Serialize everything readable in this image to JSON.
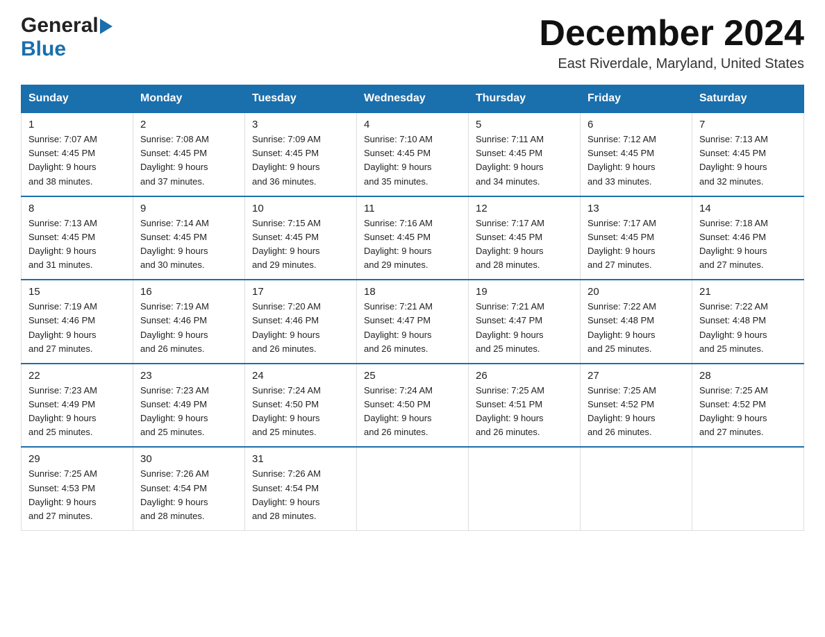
{
  "logo": {
    "general": "General",
    "blue": "Blue",
    "triangle_color": "#1a6fad"
  },
  "title": {
    "month_year": "December 2024",
    "location": "East Riverdale, Maryland, United States"
  },
  "weekdays": [
    "Sunday",
    "Monday",
    "Tuesday",
    "Wednesday",
    "Thursday",
    "Friday",
    "Saturday"
  ],
  "weeks": [
    [
      {
        "day": "1",
        "sunrise": "7:07 AM",
        "sunset": "4:45 PM",
        "daylight": "9 hours and 38 minutes."
      },
      {
        "day": "2",
        "sunrise": "7:08 AM",
        "sunset": "4:45 PM",
        "daylight": "9 hours and 37 minutes."
      },
      {
        "day": "3",
        "sunrise": "7:09 AM",
        "sunset": "4:45 PM",
        "daylight": "9 hours and 36 minutes."
      },
      {
        "day": "4",
        "sunrise": "7:10 AM",
        "sunset": "4:45 PM",
        "daylight": "9 hours and 35 minutes."
      },
      {
        "day": "5",
        "sunrise": "7:11 AM",
        "sunset": "4:45 PM",
        "daylight": "9 hours and 34 minutes."
      },
      {
        "day": "6",
        "sunrise": "7:12 AM",
        "sunset": "4:45 PM",
        "daylight": "9 hours and 33 minutes."
      },
      {
        "day": "7",
        "sunrise": "7:13 AM",
        "sunset": "4:45 PM",
        "daylight": "9 hours and 32 minutes."
      }
    ],
    [
      {
        "day": "8",
        "sunrise": "7:13 AM",
        "sunset": "4:45 PM",
        "daylight": "9 hours and 31 minutes."
      },
      {
        "day": "9",
        "sunrise": "7:14 AM",
        "sunset": "4:45 PM",
        "daylight": "9 hours and 30 minutes."
      },
      {
        "day": "10",
        "sunrise": "7:15 AM",
        "sunset": "4:45 PM",
        "daylight": "9 hours and 29 minutes."
      },
      {
        "day": "11",
        "sunrise": "7:16 AM",
        "sunset": "4:45 PM",
        "daylight": "9 hours and 29 minutes."
      },
      {
        "day": "12",
        "sunrise": "7:17 AM",
        "sunset": "4:45 PM",
        "daylight": "9 hours and 28 minutes."
      },
      {
        "day": "13",
        "sunrise": "7:17 AM",
        "sunset": "4:45 PM",
        "daylight": "9 hours and 27 minutes."
      },
      {
        "day": "14",
        "sunrise": "7:18 AM",
        "sunset": "4:46 PM",
        "daylight": "9 hours and 27 minutes."
      }
    ],
    [
      {
        "day": "15",
        "sunrise": "7:19 AM",
        "sunset": "4:46 PM",
        "daylight": "9 hours and 27 minutes."
      },
      {
        "day": "16",
        "sunrise": "7:19 AM",
        "sunset": "4:46 PM",
        "daylight": "9 hours and 26 minutes."
      },
      {
        "day": "17",
        "sunrise": "7:20 AM",
        "sunset": "4:46 PM",
        "daylight": "9 hours and 26 minutes."
      },
      {
        "day": "18",
        "sunrise": "7:21 AM",
        "sunset": "4:47 PM",
        "daylight": "9 hours and 26 minutes."
      },
      {
        "day": "19",
        "sunrise": "7:21 AM",
        "sunset": "4:47 PM",
        "daylight": "9 hours and 25 minutes."
      },
      {
        "day": "20",
        "sunrise": "7:22 AM",
        "sunset": "4:48 PM",
        "daylight": "9 hours and 25 minutes."
      },
      {
        "day": "21",
        "sunrise": "7:22 AM",
        "sunset": "4:48 PM",
        "daylight": "9 hours and 25 minutes."
      }
    ],
    [
      {
        "day": "22",
        "sunrise": "7:23 AM",
        "sunset": "4:49 PM",
        "daylight": "9 hours and 25 minutes."
      },
      {
        "day": "23",
        "sunrise": "7:23 AM",
        "sunset": "4:49 PM",
        "daylight": "9 hours and 25 minutes."
      },
      {
        "day": "24",
        "sunrise": "7:24 AM",
        "sunset": "4:50 PM",
        "daylight": "9 hours and 25 minutes."
      },
      {
        "day": "25",
        "sunrise": "7:24 AM",
        "sunset": "4:50 PM",
        "daylight": "9 hours and 26 minutes."
      },
      {
        "day": "26",
        "sunrise": "7:25 AM",
        "sunset": "4:51 PM",
        "daylight": "9 hours and 26 minutes."
      },
      {
        "day": "27",
        "sunrise": "7:25 AM",
        "sunset": "4:52 PM",
        "daylight": "9 hours and 26 minutes."
      },
      {
        "day": "28",
        "sunrise": "7:25 AM",
        "sunset": "4:52 PM",
        "daylight": "9 hours and 27 minutes."
      }
    ],
    [
      {
        "day": "29",
        "sunrise": "7:25 AM",
        "sunset": "4:53 PM",
        "daylight": "9 hours and 27 minutes."
      },
      {
        "day": "30",
        "sunrise": "7:26 AM",
        "sunset": "4:54 PM",
        "daylight": "9 hours and 28 minutes."
      },
      {
        "day": "31",
        "sunrise": "7:26 AM",
        "sunset": "4:54 PM",
        "daylight": "9 hours and 28 minutes."
      },
      null,
      null,
      null,
      null
    ]
  ],
  "labels": {
    "sunrise": "Sunrise:",
    "sunset": "Sunset:",
    "daylight": "Daylight:"
  }
}
